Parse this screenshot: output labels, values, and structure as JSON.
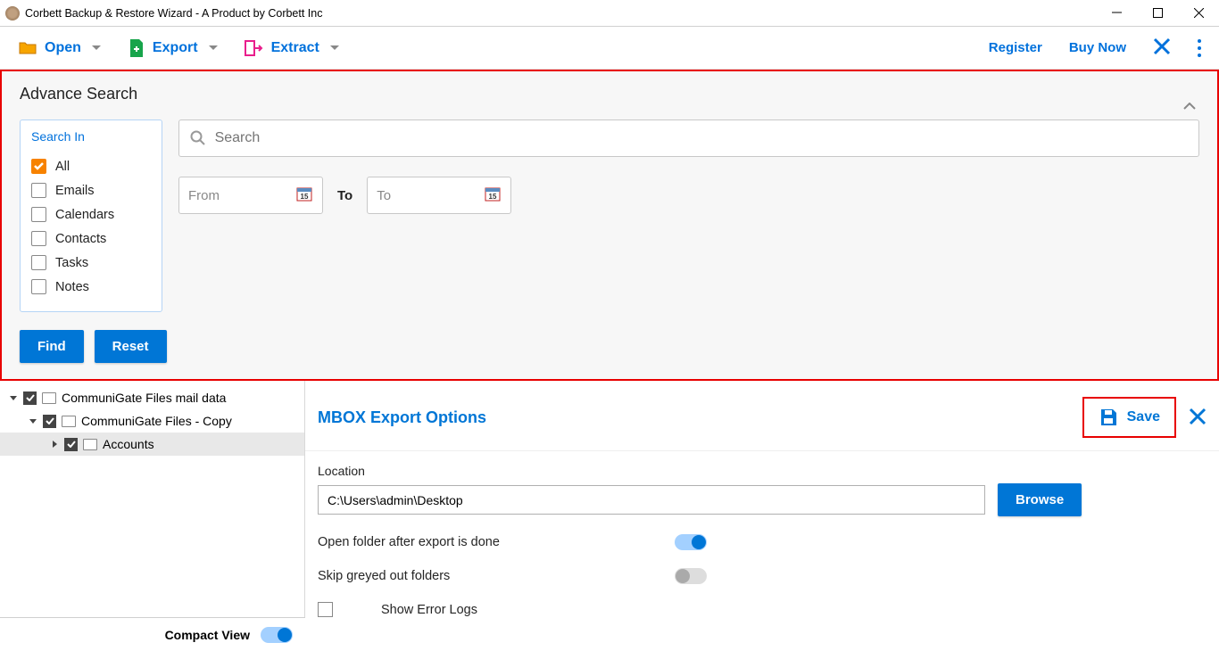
{
  "titlebar": {
    "text": "Corbett Backup & Restore Wizard - A Product by Corbett Inc"
  },
  "toolbar": {
    "open": "Open",
    "export": "Export",
    "extract": "Extract",
    "register": "Register",
    "buynow": "Buy Now"
  },
  "adv": {
    "title": "Advance Search",
    "search_in_label": "Search In",
    "options": {
      "all": "All",
      "emails": "Emails",
      "calendars": "Calendars",
      "contacts": "Contacts",
      "tasks": "Tasks",
      "notes": "Notes"
    },
    "search_placeholder": "Search",
    "from_placeholder": "From",
    "to_word": "To",
    "to_placeholder": "To",
    "find": "Find",
    "reset": "Reset"
  },
  "tree": {
    "n0": "CommuniGate Files mail data",
    "n1": "CommuniGate Files - Copy",
    "n2": "Accounts"
  },
  "compact": {
    "label": "Compact View"
  },
  "export_panel": {
    "title": "MBOX Export Options",
    "save": "Save",
    "location_label": "Location",
    "location_value": "C:\\Users\\admin\\Desktop",
    "browse": "Browse",
    "opt_open_folder": "Open folder after export is done",
    "opt_skip_grey": "Skip greyed out folders",
    "opt_show_logs": "Show Error Logs"
  }
}
